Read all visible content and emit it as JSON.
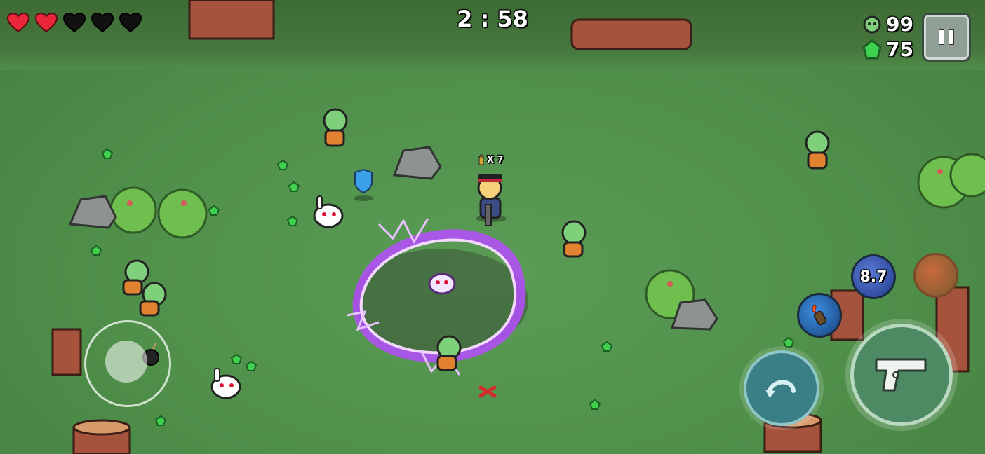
{
  "hud": {
    "hearts": [
      "full",
      "full",
      "empty",
      "empty",
      "empty"
    ],
    "timer": "2 : 58",
    "kills": "99",
    "gems": "75",
    "pause_icon": "pause-icon"
  },
  "player": {
    "ammo": "X 7"
  },
  "skills": {
    "cooldown": "8.7"
  },
  "colors": {
    "grass": "#4f8f4c",
    "heart_full": "#e8283a",
    "heart_empty": "#111111",
    "lightning": "#b64cff",
    "gem": "#3fd04d"
  },
  "icons": {
    "kill_counter": "zombie-head-icon",
    "gem_counter": "green-gem-icon",
    "dodge_button": "dodge-rotate-icon",
    "fire_button": "pistol-icon",
    "skill_a": "shadow-orb-icon",
    "skill_b": "fire-orb-icon",
    "skill_c": "molotov-icon"
  }
}
